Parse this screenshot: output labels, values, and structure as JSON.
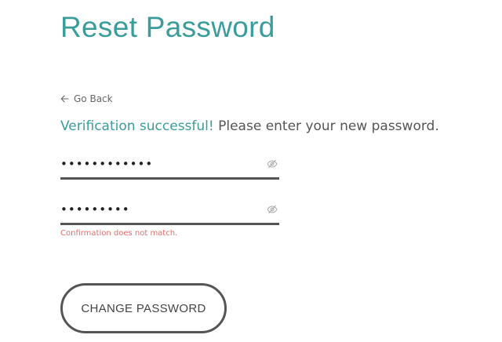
{
  "page": {
    "title": "Reset Password",
    "go_back": "Go Back",
    "message_success": "Verification successful!",
    "message_rest": " Please enter your new password."
  },
  "form": {
    "new_password_value": "••••••••••••",
    "confirm_password_value": "•••••••••",
    "error": "Confirmation does not match.",
    "submit_label": "CHANGE PASSWORD"
  },
  "icons": {
    "back": "arrow-left-icon",
    "reveal": "eye-slash-icon"
  },
  "colors": {
    "accent": "#3a9d9b",
    "error": "#e0706f",
    "text": "#555555"
  }
}
